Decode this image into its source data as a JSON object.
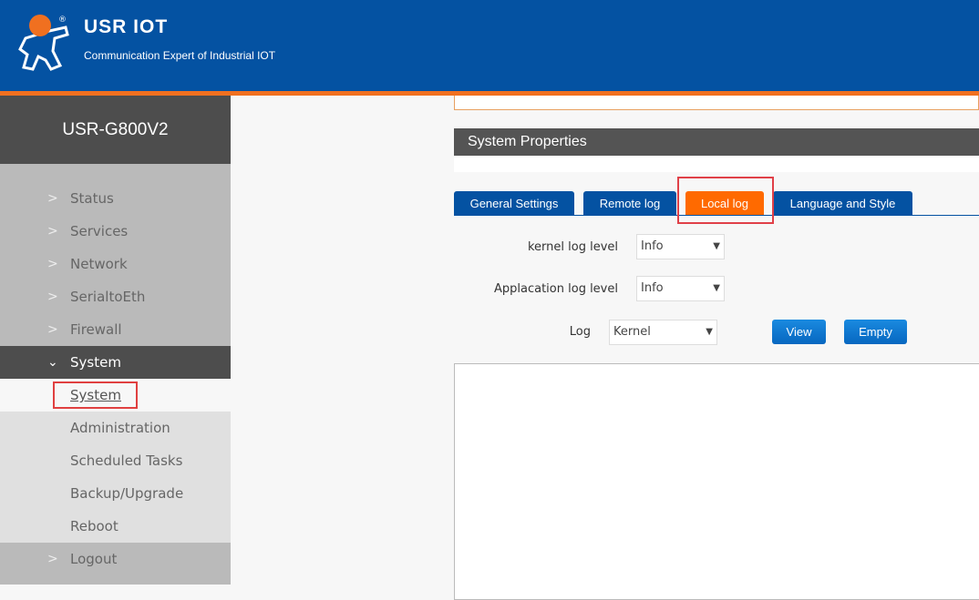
{
  "header": {
    "brand": "USR IOT",
    "slogan": "Communication Expert of Industrial IOT"
  },
  "sidebar": {
    "device": "USR-G800V2",
    "items": [
      {
        "label": "Status"
      },
      {
        "label": "Services"
      },
      {
        "label": "Network"
      },
      {
        "label": "SerialtoEth"
      },
      {
        "label": "Firewall"
      },
      {
        "label": "System"
      }
    ],
    "subitems": [
      {
        "label": "System"
      },
      {
        "label": "Administration"
      },
      {
        "label": "Scheduled Tasks"
      },
      {
        "label": "Backup/Upgrade"
      },
      {
        "label": "Reboot"
      }
    ],
    "logout": "Logout"
  },
  "main": {
    "section_title": "System Properties",
    "tabs": [
      {
        "label": "General Settings"
      },
      {
        "label": "Remote log"
      },
      {
        "label": "Local log"
      },
      {
        "label": "Language and Style"
      }
    ],
    "kernel_label": "kernel log level",
    "kernel_value": "Info",
    "app_label": "Applacation log level",
    "app_value": "Info",
    "log_label": "Log",
    "log_value": "Kernel",
    "view": "View",
    "empty": "Empty"
  },
  "colors": {
    "header": "#0452a2",
    "accent": "#ff6a00",
    "highlight": "#e04048"
  }
}
